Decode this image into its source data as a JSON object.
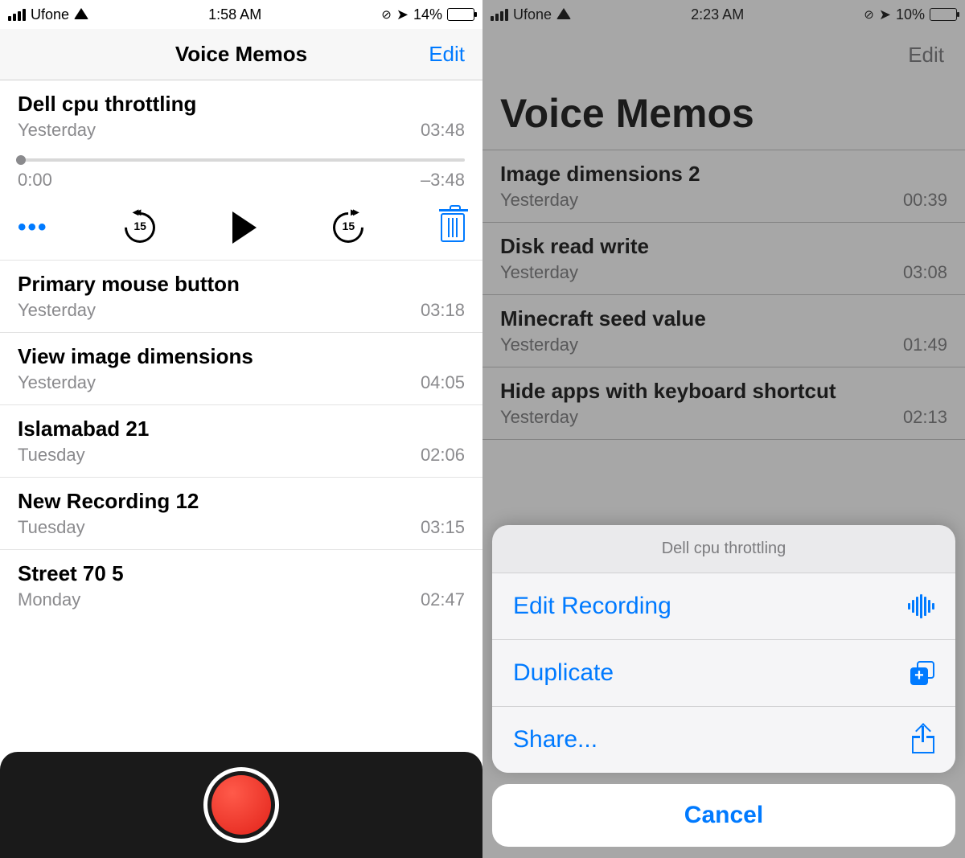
{
  "left": {
    "status": {
      "carrier": "Ufone",
      "time": "1:58 AM",
      "battery_pct": "14%",
      "battery_fill_color": "#ff3b30",
      "battery_fill_width": "14%"
    },
    "navbar": {
      "title": "Voice Memos",
      "edit": "Edit"
    },
    "expanded": {
      "title": "Dell cpu throttling",
      "date": "Yesterday",
      "duration": "03:48",
      "elapsed": "0:00",
      "remaining": "–3:48",
      "skip_seconds": "15"
    },
    "memos": [
      {
        "title": "Primary mouse button",
        "date": "Yesterday",
        "duration": "03:18"
      },
      {
        "title": "View image dimensions",
        "date": "Yesterday",
        "duration": "04:05"
      },
      {
        "title": "Islamabad 21",
        "date": "Tuesday",
        "duration": "02:06"
      },
      {
        "title": "New Recording 12",
        "date": "Tuesday",
        "duration": "03:15"
      },
      {
        "title": "Street 70 5",
        "date": "Monday",
        "duration": "02:47"
      }
    ]
  },
  "right": {
    "status": {
      "carrier": "Ufone",
      "time": "2:23 AM",
      "battery_pct": "10%",
      "battery_fill_color": "#ffcc00",
      "battery_fill_width": "10%"
    },
    "navbar": {
      "edit": "Edit"
    },
    "large_title": "Voice Memos",
    "memos": [
      {
        "title": "Image dimensions 2",
        "date": "Yesterday",
        "duration": "00:39"
      },
      {
        "title": "Disk read write",
        "date": "Yesterday",
        "duration": "03:08"
      },
      {
        "title": "Minecraft seed value",
        "date": "Yesterday",
        "duration": "01:49"
      },
      {
        "title": "Hide apps with keyboard shortcut",
        "date": "Yesterday",
        "duration": "02:13"
      }
    ],
    "sheet": {
      "header": "Dell cpu throttling",
      "items": [
        {
          "label": "Edit Recording",
          "icon": "waveform-icon"
        },
        {
          "label": "Duplicate",
          "icon": "duplicate-icon"
        },
        {
          "label": "Share...",
          "icon": "share-icon"
        }
      ],
      "cancel": "Cancel"
    }
  }
}
